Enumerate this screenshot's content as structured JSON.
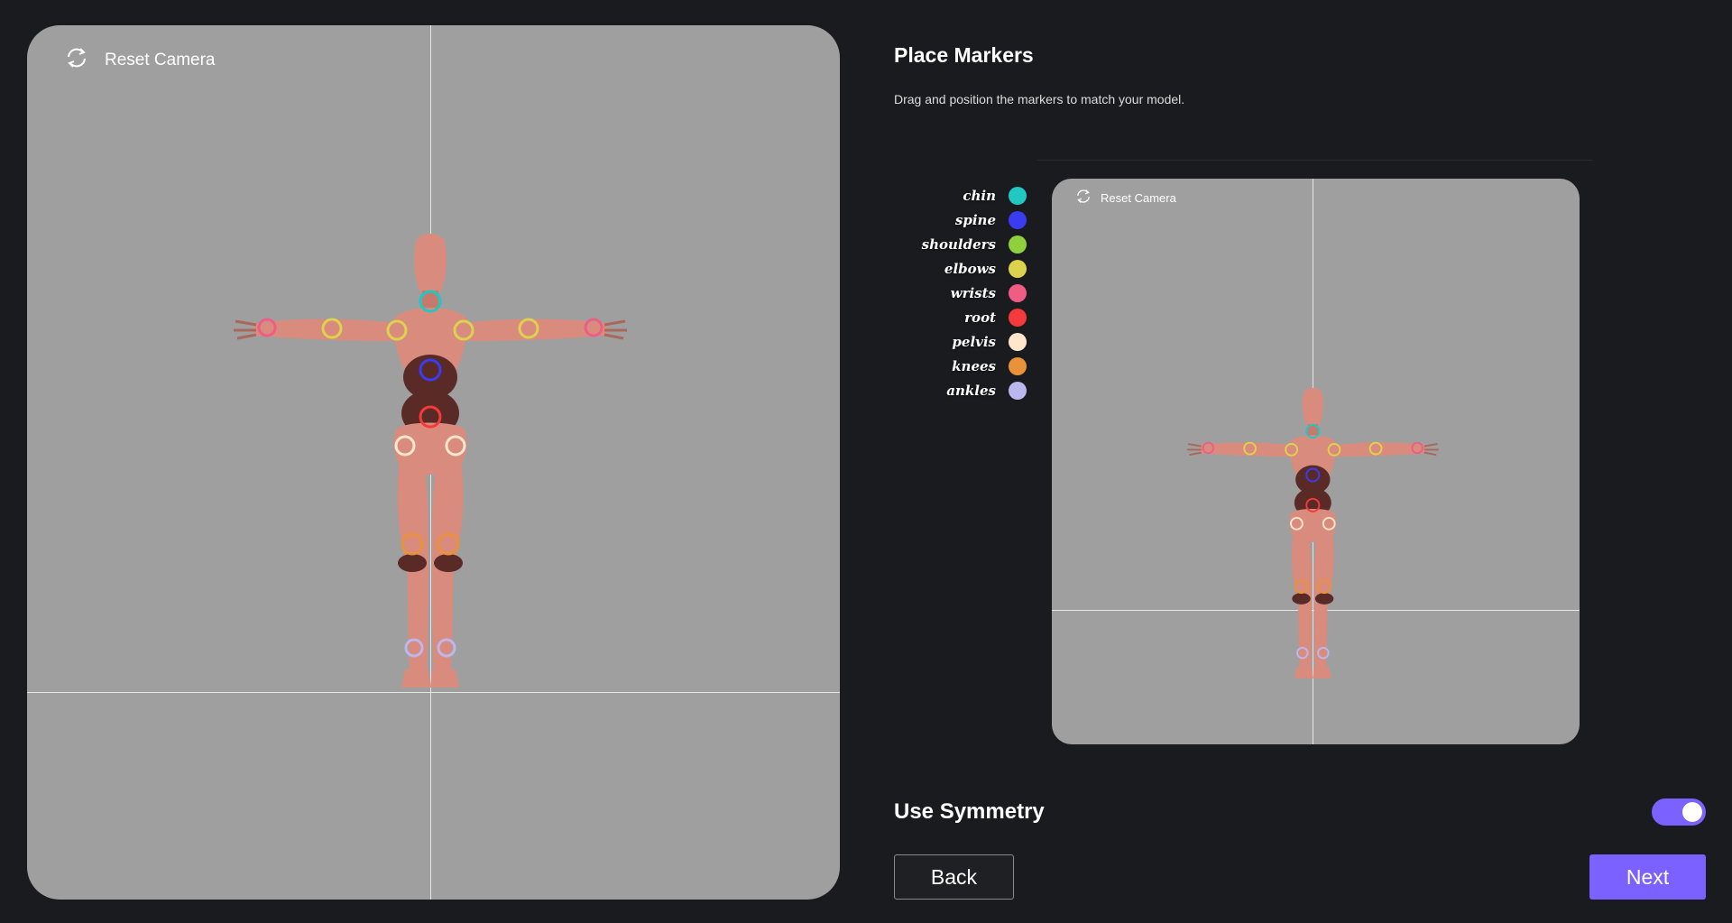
{
  "main_view": {
    "reset_camera_label": "Reset Camera",
    "refresh_icon": "refresh-icon"
  },
  "panel": {
    "title": "Place Markers",
    "subtitle": "Drag and position the markers to match your model."
  },
  "preview_view": {
    "reset_camera_label": "Reset Camera",
    "refresh_icon": "refresh-icon"
  },
  "legend": [
    {
      "label": "chin",
      "color": "#22c7c1"
    },
    {
      "label": "spine",
      "color": "#3a3cf2"
    },
    {
      "label": "shoulders",
      "color": "#8fd13c"
    },
    {
      "label": "elbows",
      "color": "#ddd24e"
    },
    {
      "label": "wrists",
      "color": "#ef5d85"
    },
    {
      "label": "root",
      "color": "#f43a3a"
    },
    {
      "label": "pelvis",
      "color": "#fde6cc"
    },
    {
      "label": "knees",
      "color": "#e9923a"
    },
    {
      "label": "ankles",
      "color": "#bcb7ee"
    }
  ],
  "symmetry": {
    "label": "Use Symmetry",
    "enabled": true
  },
  "buttons": {
    "back": "Back",
    "next": "Next"
  },
  "colors": {
    "accent": "#7b61ff",
    "background": "#1a1b1f",
    "viewport": "#9f9f9f",
    "skin": "#d98c7e"
  }
}
